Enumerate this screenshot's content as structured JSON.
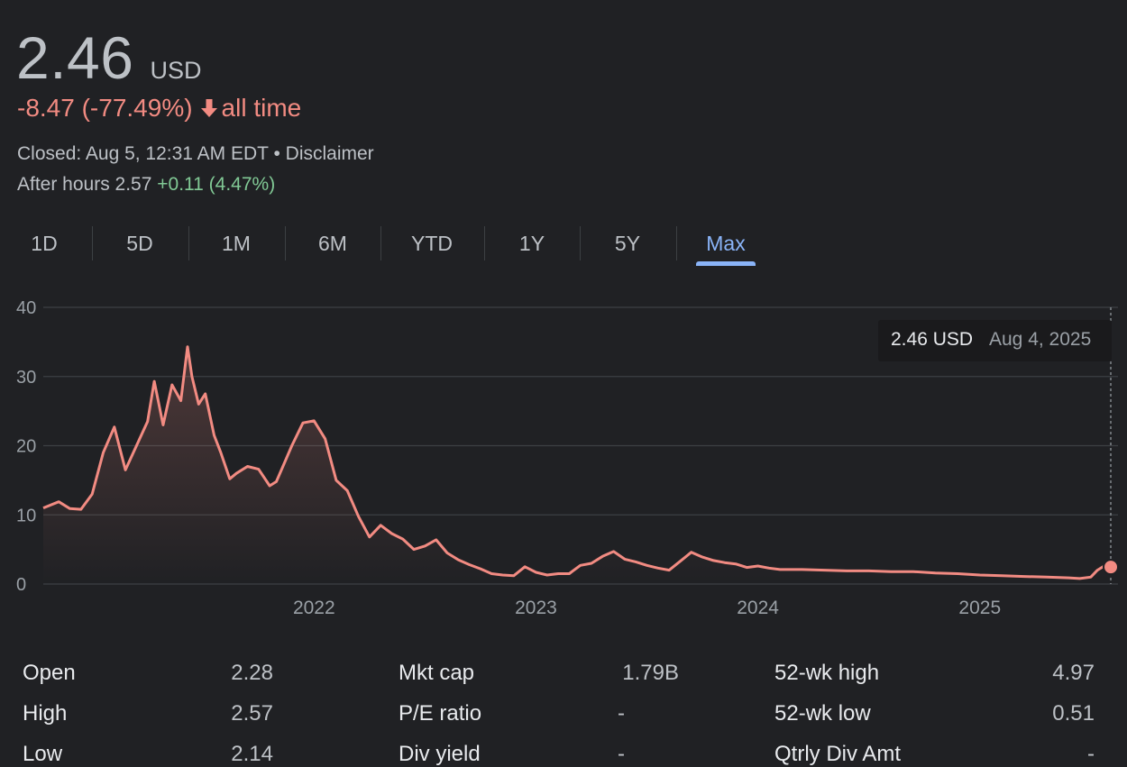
{
  "quote": {
    "price": "2.46",
    "currency": "USD",
    "change": "-8.47 (-77.49%)",
    "change_period": "all time",
    "closed_text": "Closed: Aug 5, 12:31 AM EDT",
    "separator": "•",
    "disclaimer": "Disclaimer",
    "after_hours_label": "After hours 2.57",
    "after_hours_change": "+0.11 (4.47%)"
  },
  "tabs": [
    {
      "label": "1D"
    },
    {
      "label": "5D"
    },
    {
      "label": "1M"
    },
    {
      "label": "6M"
    },
    {
      "label": "YTD"
    },
    {
      "label": "1Y"
    },
    {
      "label": "5Y"
    },
    {
      "label": "Max",
      "active": true
    }
  ],
  "tooltip": {
    "price": "2.46 USD",
    "date": "Aug 4, 2025"
  },
  "colors": {
    "line": "#f28b82",
    "accent": "#8ab4f8",
    "positive": "#81c995",
    "grid": "#3c4043",
    "background": "#202124"
  },
  "chart_data": {
    "type": "line",
    "ylim": [
      0,
      40
    ],
    "yticks": [
      0,
      10,
      20,
      30,
      40
    ],
    "xticks": [
      "2022",
      "2023",
      "2024",
      "2025"
    ],
    "grid": true,
    "series": [
      {
        "x": [
          2020.78,
          2020.85,
          2020.9,
          2020.95,
          2021.0,
          2021.05,
          2021.1,
          2021.15,
          2021.2,
          2021.25,
          2021.28,
          2021.32,
          2021.36,
          2021.4,
          2021.43,
          2021.45,
          2021.48,
          2021.51,
          2021.55,
          2021.58,
          2021.62,
          2021.65,
          2021.7,
          2021.75,
          2021.8,
          2021.83,
          2021.86,
          2021.9,
          2021.95,
          2022.0,
          2022.05,
          2022.1,
          2022.15,
          2022.2,
          2022.25,
          2022.3,
          2022.35,
          2022.4,
          2022.45,
          2022.5,
          2022.55,
          2022.6,
          2022.65,
          2022.7,
          2022.75,
          2022.8,
          2022.85,
          2022.9,
          2022.95,
          2023.0,
          2023.05,
          2023.1,
          2023.15,
          2023.2,
          2023.25,
          2023.3,
          2023.35,
          2023.4,
          2023.45,
          2023.5,
          2023.55,
          2023.6,
          2023.65,
          2023.7,
          2023.75,
          2023.8,
          2023.85,
          2023.9,
          2023.95,
          2024.0,
          2024.05,
          2024.1,
          2024.2,
          2024.3,
          2024.4,
          2024.5,
          2024.6,
          2024.7,
          2024.8,
          2024.9,
          2025.0,
          2025.1,
          2025.2,
          2025.3,
          2025.4,
          2025.45,
          2025.5,
          2025.53,
          2025.56,
          2025.59
        ],
        "y": [
          11.0,
          11.9,
          10.9,
          10.8,
          13.0,
          19.0,
          22.7,
          16.5,
          20.0,
          23.5,
          29.3,
          23.0,
          28.8,
          26.5,
          34.3,
          30.0,
          26.0,
          27.5,
          21.5,
          19.0,
          15.2,
          16.0,
          17.0,
          16.6,
          14.2,
          14.8,
          17.0,
          20.0,
          23.3,
          23.6,
          21.0,
          15.0,
          13.5,
          9.8,
          6.8,
          8.5,
          7.3,
          6.5,
          5.0,
          5.5,
          6.4,
          4.5,
          3.5,
          2.8,
          2.2,
          1.5,
          1.3,
          1.2,
          2.5,
          1.7,
          1.3,
          1.5,
          1.5,
          2.7,
          3.0,
          4.0,
          4.7,
          3.6,
          3.2,
          2.7,
          2.3,
          2.0,
          3.3,
          4.6,
          3.9,
          3.4,
          3.1,
          2.9,
          2.4,
          2.6,
          2.3,
          2.1,
          2.1,
          2.0,
          1.9,
          1.9,
          1.8,
          1.8,
          1.6,
          1.5,
          1.3,
          1.2,
          1.1,
          1.0,
          0.9,
          0.8,
          1.0,
          2.0,
          2.6,
          2.46
        ]
      }
    ]
  },
  "stats": {
    "col1": [
      {
        "label": "Open",
        "value": "2.28"
      },
      {
        "label": "High",
        "value": "2.57"
      },
      {
        "label": "Low",
        "value": "2.14"
      }
    ],
    "col2": [
      {
        "label": "Mkt cap",
        "value": "1.79B"
      },
      {
        "label": "P/E ratio",
        "value": "-"
      },
      {
        "label": "Div yield",
        "value": "-"
      }
    ],
    "col3": [
      {
        "label": "52-wk high",
        "value": "4.97"
      },
      {
        "label": "52-wk low",
        "value": "0.51"
      },
      {
        "label": "Qtrly Div Amt",
        "value": "-"
      }
    ]
  }
}
